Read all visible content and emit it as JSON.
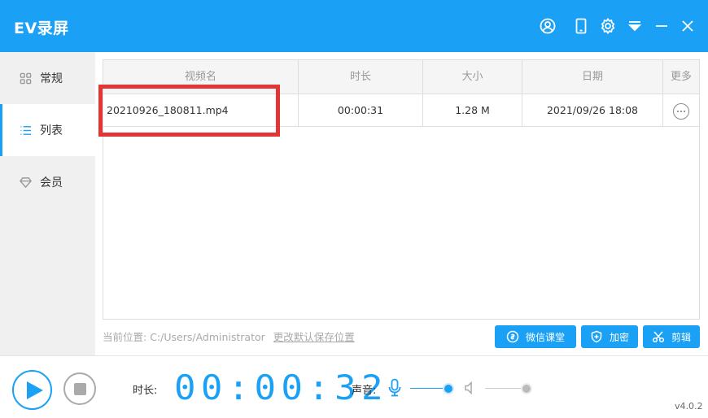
{
  "app": {
    "title": "EV录屏"
  },
  "titlebar_icons": [
    "user-icon",
    "phone-icon",
    "settings-icon",
    "dropdown-icon",
    "minimize-icon",
    "close-icon"
  ],
  "sidebar": {
    "items": [
      {
        "label": "常规",
        "icon": "grid-icon",
        "active": false
      },
      {
        "label": "列表",
        "icon": "list-icon",
        "active": true
      },
      {
        "label": "会员",
        "icon": "diamond-icon",
        "active": false
      }
    ]
  },
  "table": {
    "headers": [
      "视频名",
      "时长",
      "大小",
      "日期",
      "更多"
    ],
    "rows": [
      {
        "name": "20210926_180811.mp4",
        "duration": "00:00:31",
        "size": "1.28 M",
        "date": "2021/09/26 18:08"
      }
    ]
  },
  "path": {
    "label": "当前位置:",
    "value": "C:/Users/Administrator",
    "change_link": "更改默认保存位置"
  },
  "buttons": {
    "wechat": "微信课堂",
    "encrypt": "加密",
    "edit": "剪辑"
  },
  "bottom": {
    "duration_label": "时长:",
    "timer": "00:00:32",
    "volume_label": "声音:",
    "mic_level": 1.0,
    "speaker_level": 1.0,
    "version": "v4.0.2"
  },
  "colors": {
    "accent": "#1aa1f5",
    "highlight": "#e23636"
  }
}
